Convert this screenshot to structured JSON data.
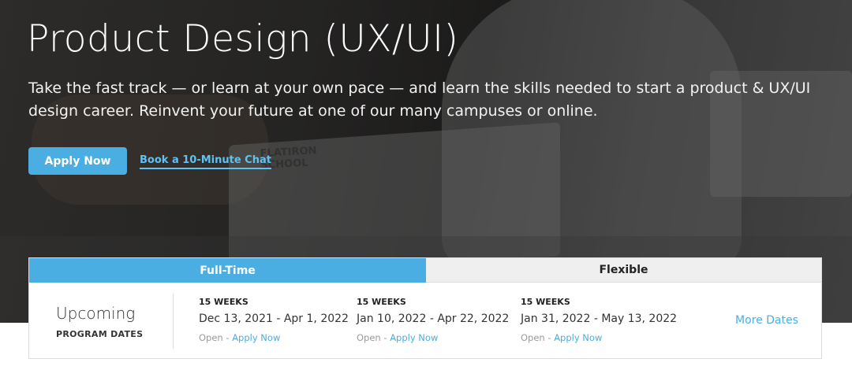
{
  "hero": {
    "title": "Product Design (UX/UI)",
    "subtitle": "Take the fast track — or learn at your own pace — and learn the skills needed to start a product & UX/UI design career. Reinvent your future at one of our many campuses or online.",
    "apply_label": "Apply Now",
    "chat_label": "Book a 10-Minute Chat",
    "laptop_sticker": "FLATIRON\nSCHOOL"
  },
  "schedule": {
    "tabs": [
      {
        "label": "Full-Time",
        "active": true
      },
      {
        "label": "Flexible",
        "active": false
      }
    ],
    "heading": "Upcoming",
    "subheading": "PROGRAM DATES",
    "cohorts": [
      {
        "duration": "15 WEEKS",
        "range": "Dec 13, 2021 - Apr 1, 2022",
        "status": "Open",
        "separator": " - ",
        "action": "Apply Now"
      },
      {
        "duration": "15 WEEKS",
        "range": "Jan 10, 2022 - Apr 22, 2022",
        "status": "Open",
        "separator": " - ",
        "action": "Apply Now"
      },
      {
        "duration": "15 WEEKS",
        "range": "Jan 31, 2022 - May 13, 2022",
        "status": "Open",
        "separator": " - ",
        "action": "Apply Now"
      }
    ],
    "more_dates_label": "More Dates"
  },
  "colors": {
    "accent": "#4aaee2",
    "link_light": "#5ec2f2",
    "muted_text": "#9a9a9a"
  }
}
